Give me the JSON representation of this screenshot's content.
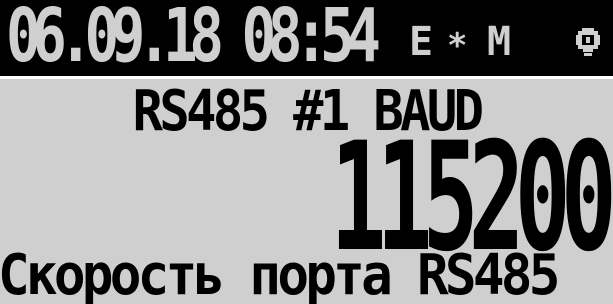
{
  "status_bar": {
    "datetime": "06.09.18 08:54",
    "flag_e": "E",
    "flag_star": "*",
    "flag_m": "M",
    "icon": "lamp-icon"
  },
  "parameter": {
    "title": "RS485 #1 BAUD",
    "value": "115200",
    "description": "Скорость порта RS485"
  },
  "colors": {
    "screen_background": "#cfcfcf",
    "status_bar_background": "#000000",
    "text": "#000000"
  }
}
